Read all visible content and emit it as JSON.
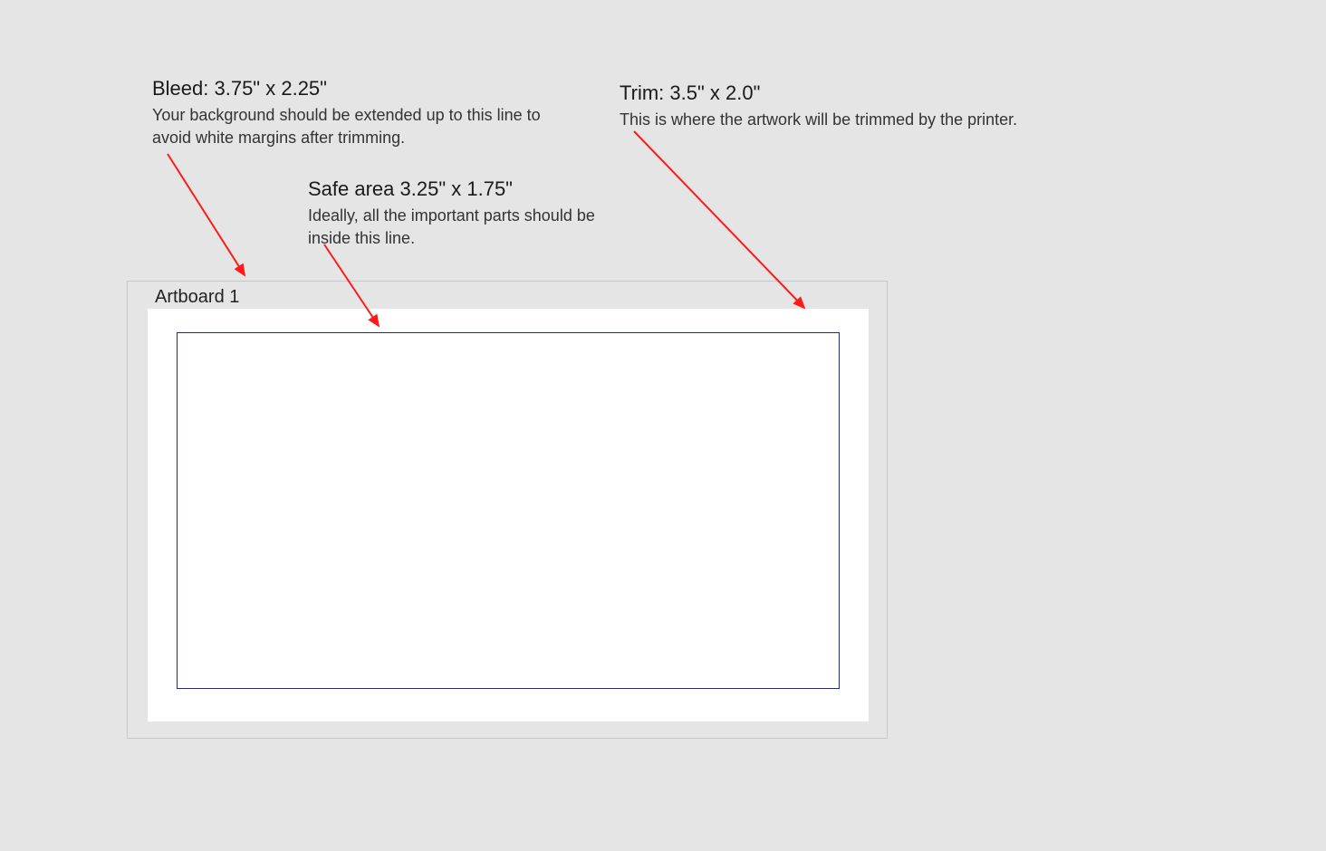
{
  "annotations": {
    "bleed": {
      "title": "Bleed: 3.75\" x 2.25\"",
      "description": "Your background should be extended up to this line to avoid white margins after trimming."
    },
    "safe": {
      "title": "Safe area 3.25\" x 1.75\"",
      "description": "Ideally, all the important parts should be inside this line."
    },
    "trim": {
      "title": "Trim: 3.5\" x 2.0\"",
      "description": "This is where the artwork will be trimmed by the printer."
    }
  },
  "artboard": {
    "label": "Artboard 1"
  },
  "dimensions": {
    "bleed": {
      "width_in": 3.75,
      "height_in": 2.25
    },
    "trim": {
      "width_in": 3.5,
      "height_in": 2.0
    },
    "safe": {
      "width_in": 3.25,
      "height_in": 1.75
    }
  },
  "colors": {
    "arrow": "#ff1a1a",
    "trim_border": "#1a2a8a",
    "artboard_border": "#c8c8c8",
    "background": "#e5e5e5",
    "canvas": "#ffffff"
  }
}
